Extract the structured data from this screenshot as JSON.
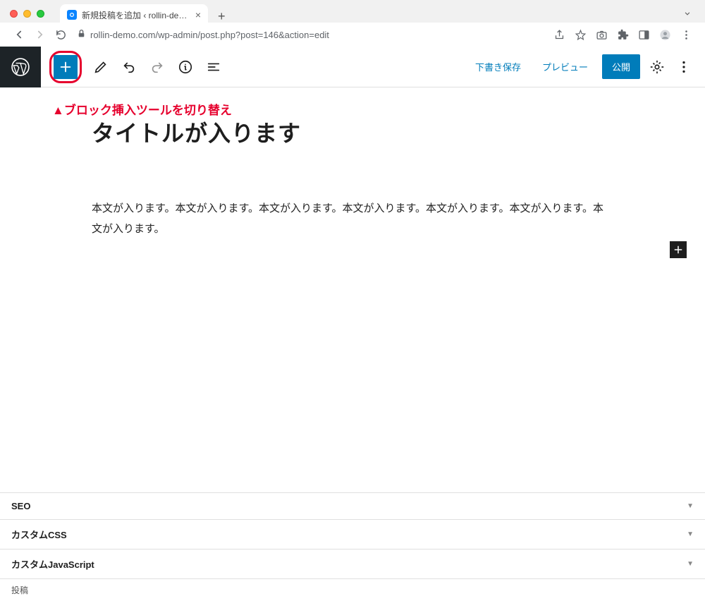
{
  "browser": {
    "tab_title": "新規投稿を追加 ‹ rollin-demo —",
    "url": "rollin-demo.com/wp-admin/post.php?post=146&action=edit"
  },
  "toolbar": {
    "save_draft": "下書き保存",
    "preview": "プレビュー",
    "publish": "公開"
  },
  "annotation": "▲ブロック挿入ツールを切り替え",
  "post": {
    "title": "タイトルが入ります",
    "body": "本文が入ります。本文が入ります。本文が入ります。本文が入ります。本文が入ります。本文が入ります。本文が入ります。"
  },
  "panels": [
    {
      "label": "SEO"
    },
    {
      "label": "カスタムCSS"
    },
    {
      "label": "カスタムJavaScript"
    }
  ],
  "footer": {
    "label": "投稿"
  }
}
